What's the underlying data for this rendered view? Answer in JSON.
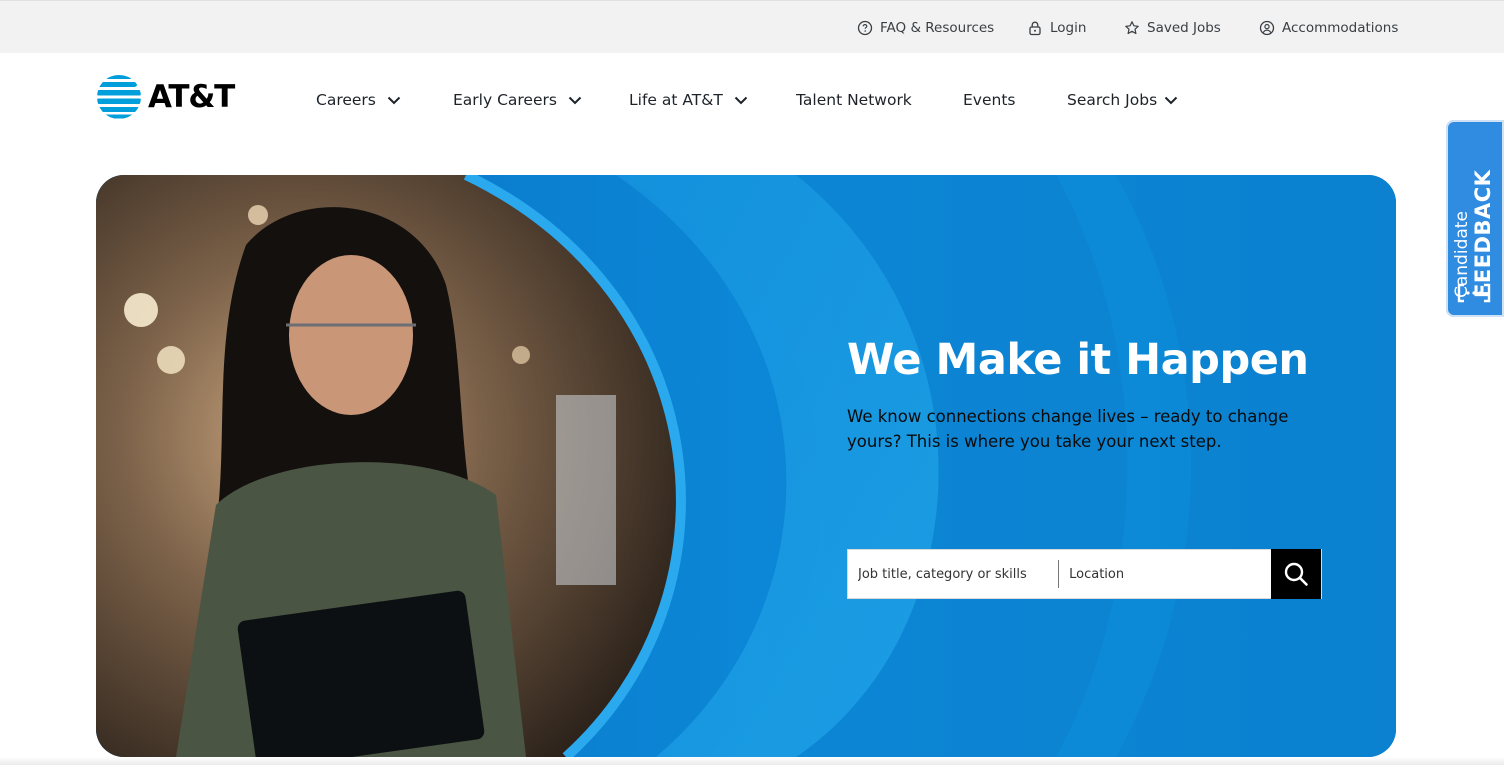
{
  "utility_bar": {
    "items": [
      {
        "label": "FAQ & Resources",
        "icon": "question-circle-icon"
      },
      {
        "label": "Login",
        "icon": "lock-icon"
      },
      {
        "label": "Saved Jobs",
        "icon": "star-icon"
      },
      {
        "label": "Accommodations",
        "icon": "user-circle-icon"
      }
    ]
  },
  "header": {
    "logo_text": "AT&T",
    "nav": [
      {
        "label": "Careers",
        "has_dropdown": true
      },
      {
        "label": "Early Careers",
        "has_dropdown": true
      },
      {
        "label": "Life at AT&T",
        "has_dropdown": true
      },
      {
        "label": "Talent Network",
        "has_dropdown": false
      },
      {
        "label": "Events",
        "has_dropdown": false
      },
      {
        "label": "Search Jobs",
        "has_dropdown": true
      }
    ]
  },
  "hero": {
    "title": "We Make it Happen",
    "subtitle": "We know connections change lives – ready to change yours? This is where you take your next step.",
    "search": {
      "job_placeholder": "Job title, category or skills",
      "location_placeholder": "Location",
      "button_icon": "search-icon"
    }
  },
  "feedback": {
    "line1": "Candidate",
    "line2": "FEEDBACK",
    "icon": "speech-bracket-icon"
  },
  "colors": {
    "brand_blue": "#009fdb",
    "hero_blue": "#0b7fd0",
    "utility_bg": "#f2f2f2",
    "feedback_bg": "#2f8ce0"
  }
}
